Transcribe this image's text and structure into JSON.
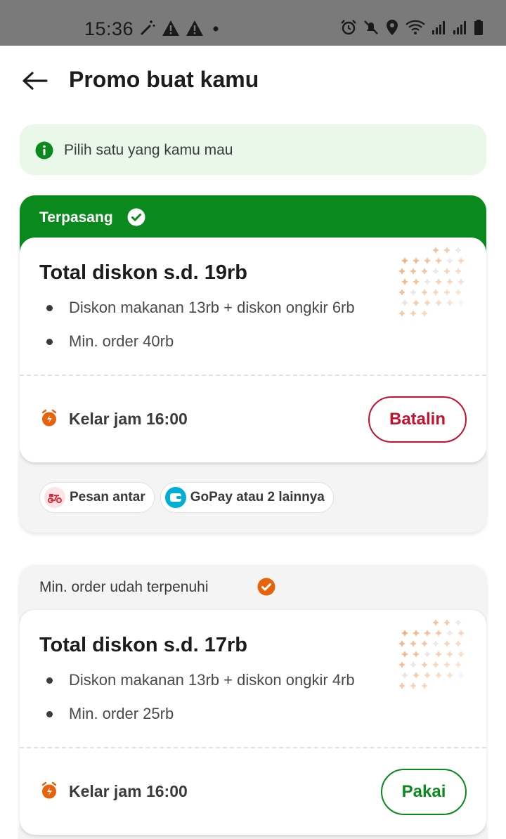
{
  "statusbar": {
    "time": "15:36"
  },
  "header": {
    "title": "Promo buat kamu"
  },
  "info": {
    "text": "Pilih satu yang kamu mau"
  },
  "promos": [
    {
      "status_label": "Terpasang",
      "heading": "Total diskon s.d. 19rb",
      "bullets": [
        "Diskon makanan 13rb + diskon ongkir 6rb",
        "Min. order 40rb"
      ],
      "expiry": "Kelar jam 16:00",
      "action_label": "Batalin",
      "chips": [
        "Pesan antar",
        "GoPay atau 2 lainnya"
      ]
    },
    {
      "status_label": "Min. order udah terpenuhi",
      "heading": "Total diskon s.d. 17rb",
      "bullets": [
        "Diskon makanan 13rb + diskon ongkir 4rb",
        "Min. order 25rb"
      ],
      "expiry": "Kelar jam 16:00",
      "action_label": "Pakai"
    }
  ],
  "colors": {
    "applied_green": "#0a8a1c",
    "cancel_red": "#c8102e",
    "info_bg": "#e9f8e8",
    "accent_orange": "#e8620c"
  }
}
